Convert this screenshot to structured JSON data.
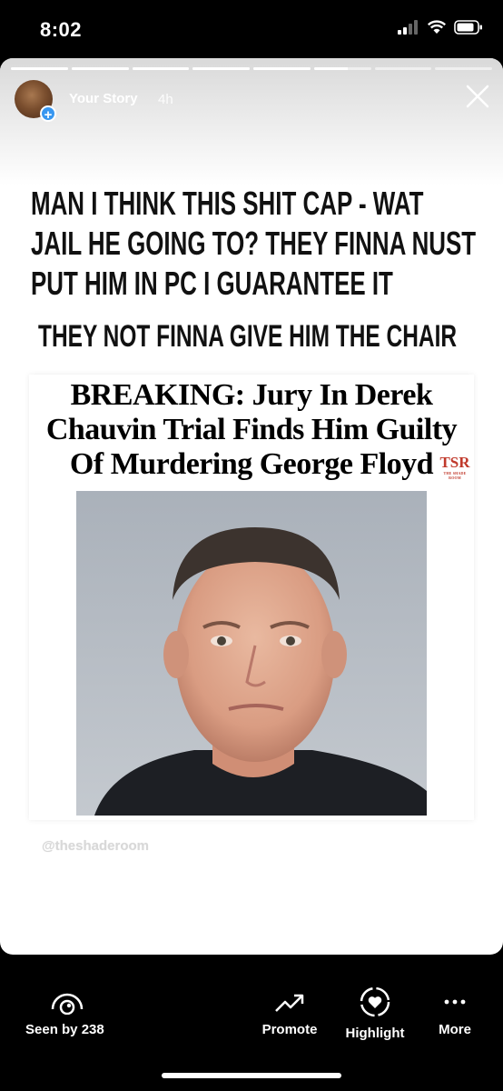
{
  "status_bar": {
    "time": "8:02"
  },
  "story": {
    "user": "Your Story",
    "time_ago": "4h",
    "progress": {
      "segments": 8,
      "current_segment": 6,
      "current_fraction": 0.6
    },
    "caption_lines": [
      "MAN I THINK THIS SHIT CAP - WAT",
      "JAIL HE GOING TO? THEY FINNA NUST",
      "PUT HIM IN PC I GUARANTEE IT"
    ],
    "caption_sub": "THEY NOT FINNA GIVE HIM THE CHAIR",
    "news_card": {
      "headline_lines": [
        "BREAKING: Jury In Derek",
        "Chauvin Trial Finds Him Guilty",
        "Of Murdering George Floyd"
      ],
      "logo_text": "TSR",
      "logo_subtext": "THE SHADE ROOM"
    },
    "watermark": "@theshaderoom"
  },
  "bottom_actions": {
    "seen_by": "Seen by 238",
    "promote": "Promote",
    "highlight": "Highlight",
    "more": "More"
  }
}
